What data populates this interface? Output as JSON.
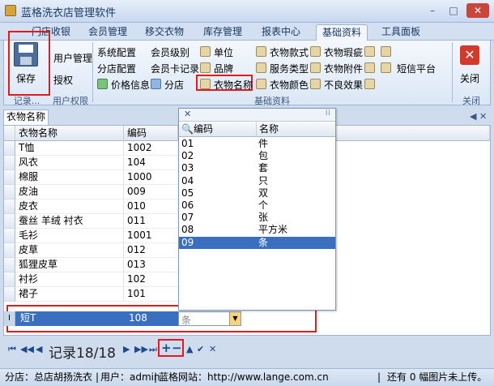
{
  "window": {
    "title": "蓝格洗衣店管理软件",
    "min": "–",
    "max": "□",
    "close": "✕"
  },
  "tabs": [
    "门店收银",
    "会员管理",
    "移交衣物",
    "库存管理",
    "报表中心",
    "基础资料",
    "工具面板"
  ],
  "active_tab": "基础资料",
  "ribbon": {
    "save": {
      "label": "保存"
    },
    "user_mgmt": "用户管理",
    "auth": "授权",
    "group_records": "记录...",
    "group_user_perm": "用户权限",
    "col1": [
      "系统配置",
      "分店配置",
      "价格信息"
    ],
    "col2": [
      "会员级别",
      "会员卡记录",
      "分店"
    ],
    "col3": [
      "单位",
      "品牌",
      "衣物名称"
    ],
    "col4": [
      "衣物款式",
      "服务类型",
      "衣物颜色"
    ],
    "col5": [
      "衣物瑕疵",
      "衣物附件",
      "不良效果"
    ],
    "sms": "短信平台",
    "group_basic": "基础资料",
    "close": {
      "label": "关闭"
    },
    "group_close": "关闭"
  },
  "document_tab": "衣物名称",
  "grid": {
    "headers": [
      "衣物名称",
      "编码"
    ],
    "rows": [
      [
        "T恤",
        "1002"
      ],
      [
        "风衣",
        "104"
      ],
      [
        "棉服",
        "1000"
      ],
      [
        "皮油",
        "009"
      ],
      [
        "皮衣",
        "010"
      ],
      [
        "蚕丝 羊绒 衬衣",
        "011"
      ],
      [
        "毛衫",
        "1001"
      ],
      [
        "皮草",
        "012"
      ],
      [
        "狐狸皮草",
        "013"
      ],
      [
        "衬衫",
        "102"
      ],
      [
        "裙子",
        "101"
      ]
    ],
    "edit_row": {
      "name": "短T",
      "code": "108",
      "unit": "条"
    }
  },
  "dropdown": {
    "headers": [
      "编码",
      "名称"
    ],
    "rows": [
      [
        "01",
        "件"
      ],
      [
        "02",
        "包"
      ],
      [
        "03",
        "套"
      ],
      [
        "04",
        "只"
      ],
      [
        "05",
        "双"
      ],
      [
        "06",
        "个"
      ],
      [
        "07",
        "张"
      ],
      [
        "08",
        "平方米"
      ],
      [
        "09",
        "条"
      ]
    ],
    "selected_index": 8
  },
  "nav": {
    "record": "记录18/18",
    "first": "⏮",
    "prev_page": "◀◀",
    "prev": "◀",
    "next": "▶",
    "next_page": "▶▶",
    "last": "⏭",
    "add": "+",
    "remove": "−",
    "up": "▲",
    "confirm": "✔",
    "cancel": "✕"
  },
  "status": {
    "store": "分店：总店胡扬洗衣",
    "user": "用户：admin",
    "site": "蓝格网站：http://www.lange.com.cn",
    "images": "还有 0 幅图片未上传。"
  }
}
